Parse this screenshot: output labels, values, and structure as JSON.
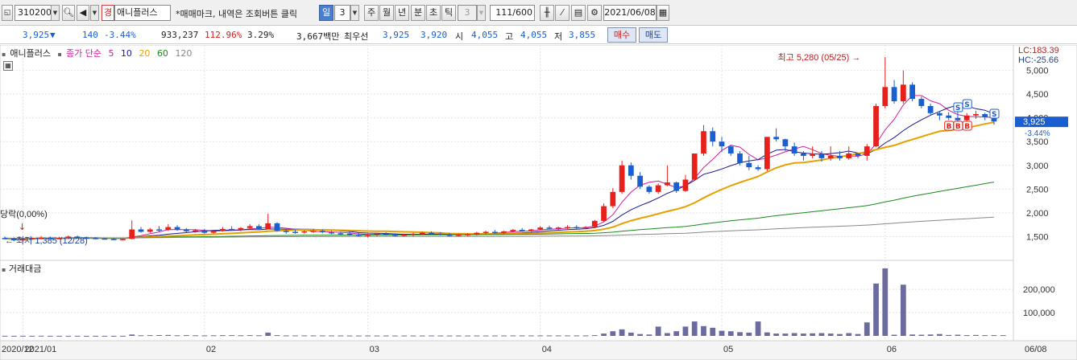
{
  "toolbar": {
    "code": "310200",
    "name_badge": "경",
    "name": "애니플러스",
    "notice": "*매매마크, 내역은 조회버튼 클릭",
    "period_tabs": [
      "일",
      "주",
      "월",
      "년",
      "분",
      "초",
      "틱"
    ],
    "active_period": "일",
    "period_value": "3",
    "minute_value": "3",
    "count": "111/600",
    "date": "2021/06/08"
  },
  "quote": {
    "price": "3,925",
    "change_arrow": "▼",
    "change": "140",
    "change_rate": "-3.44%",
    "volume": "933,237",
    "vol_ratio": "112.96%",
    "turnover": "3.29%",
    "amount": "3,667백만",
    "best_ask_label": "최우선",
    "best_ask": "3,925",
    "best_bid": "3,920",
    "open_label": "시",
    "open": "4,055",
    "high_label": "고",
    "high": "4,055",
    "low_label": "저",
    "low": "3,855",
    "buy_label": "매수",
    "sell_label": "매도"
  },
  "legend": {
    "name": "애니플러스",
    "ma_label": "종가 단순",
    "ma_periods": [
      "5",
      "10",
      "20",
      "60",
      "120"
    ],
    "ma_colors": [
      "#d0209c",
      "#1a1a8c",
      "#e8a000",
      "#1a8a1a",
      "#888888"
    ]
  },
  "volume_label": "거래대금",
  "annotations": {
    "high": "최고 5,280 (05/25) →",
    "low": "← 최저 1,385 (12/28)",
    "change_mark": "당락(0,00%)",
    "lc": "LC:183.39",
    "hc": "HC:-25.66",
    "current_price": "3,925",
    "current_rate": "-3.44%"
  },
  "colors": {
    "up": "#e8201c",
    "down": "#1a5fd0",
    "volume": "#6b6ba0",
    "price_box": "#1a5fd0"
  },
  "chart_data": {
    "type": "candlestick",
    "price_axis": {
      "ticks": [
        "5,000",
        "4,500",
        "4,000",
        "3,500",
        "3,000",
        "2,500",
        "2,000",
        "1,500"
      ],
      "min": 1100,
      "max": 5400
    },
    "volume_axis": {
      "ticks": [
        "200,000",
        "100,000"
      ],
      "max": 290000
    },
    "x_labels": [
      "2020/12",
      "2021/01",
      "02",
      "03",
      "04",
      "05",
      "06",
      "06/08"
    ],
    "x_label_index": [
      0,
      2,
      22,
      40,
      59,
      79,
      97,
      110
    ],
    "candles": [
      [
        1470,
        1500,
        1440,
        1460
      ],
      [
        1460,
        1480,
        1400,
        1420
      ],
      [
        1420,
        1460,
        1385,
        1450
      ],
      [
        1450,
        1480,
        1430,
        1470
      ],
      [
        1470,
        1510,
        1450,
        1480
      ],
      [
        1480,
        1500,
        1450,
        1460
      ],
      [
        1460,
        1490,
        1440,
        1470
      ],
      [
        1470,
        1520,
        1450,
        1500
      ],
      [
        1500,
        1520,
        1470,
        1480
      ],
      [
        1480,
        1500,
        1460,
        1470
      ],
      [
        1470,
        1490,
        1440,
        1460
      ],
      [
        1460,
        1480,
        1440,
        1450
      ],
      [
        1450,
        1470,
        1430,
        1440
      ],
      [
        1440,
        1460,
        1420,
        1450
      ],
      [
        1450,
        1840,
        1440,
        1650
      ],
      [
        1650,
        1700,
        1580,
        1600
      ],
      [
        1600,
        1680,
        1580,
        1650
      ],
      [
        1650,
        1720,
        1600,
        1640
      ],
      [
        1640,
        1760,
        1620,
        1700
      ],
      [
        1700,
        1740,
        1620,
        1640
      ],
      [
        1640,
        1680,
        1580,
        1610
      ],
      [
        1610,
        1660,
        1580,
        1630
      ],
      [
        1630,
        1660,
        1560,
        1580
      ],
      [
        1580,
        1640,
        1560,
        1620
      ],
      [
        1620,
        1700,
        1600,
        1660
      ],
      [
        1660,
        1720,
        1620,
        1640
      ],
      [
        1640,
        1700,
        1610,
        1680
      ],
      [
        1680,
        1760,
        1650,
        1720
      ],
      [
        1720,
        1760,
        1640,
        1660
      ],
      [
        1660,
        1980,
        1650,
        1780
      ],
      [
        1780,
        1800,
        1600,
        1620
      ],
      [
        1620,
        1660,
        1560,
        1600
      ],
      [
        1600,
        1640,
        1560,
        1590
      ],
      [
        1590,
        1630,
        1560,
        1610
      ],
      [
        1610,
        1660,
        1580,
        1620
      ],
      [
        1620,
        1650,
        1570,
        1590
      ],
      [
        1590,
        1620,
        1550,
        1570
      ],
      [
        1570,
        1600,
        1530,
        1560
      ],
      [
        1560,
        1600,
        1520,
        1540
      ],
      [
        1540,
        1580,
        1500,
        1520
      ],
      [
        1520,
        1560,
        1480,
        1540
      ],
      [
        1540,
        1580,
        1510,
        1560
      ],
      [
        1560,
        1590,
        1520,
        1540
      ],
      [
        1540,
        1570,
        1500,
        1520
      ],
      [
        1520,
        1560,
        1500,
        1540
      ],
      [
        1540,
        1580,
        1510,
        1560
      ],
      [
        1560,
        1600,
        1530,
        1580
      ],
      [
        1580,
        1610,
        1540,
        1560
      ],
      [
        1560,
        1590,
        1520,
        1540
      ],
      [
        1540,
        1580,
        1500,
        1520
      ],
      [
        1520,
        1560,
        1500,
        1540
      ],
      [
        1540,
        1570,
        1510,
        1550
      ],
      [
        1550,
        1600,
        1520,
        1580
      ],
      [
        1580,
        1620,
        1550,
        1600
      ],
      [
        1600,
        1640,
        1560,
        1580
      ],
      [
        1580,
        1620,
        1550,
        1610
      ],
      [
        1610,
        1660,
        1590,
        1640
      ],
      [
        1640,
        1680,
        1600,
        1620
      ],
      [
        1620,
        1660,
        1600,
        1650
      ],
      [
        1650,
        1720,
        1630,
        1690
      ],
      [
        1690,
        1730,
        1650,
        1670
      ],
      [
        1670,
        1710,
        1640,
        1690
      ],
      [
        1690,
        1740,
        1660,
        1700
      ],
      [
        1700,
        1740,
        1660,
        1680
      ],
      [
        1680,
        1720,
        1650,
        1700
      ],
      [
        1700,
        1850,
        1690,
        1830
      ],
      [
        1830,
        2200,
        1800,
        2140
      ],
      [
        2140,
        2520,
        2100,
        2440
      ],
      [
        2440,
        3100,
        2400,
        3000
      ],
      [
        3000,
        3060,
        2700,
        2780
      ],
      [
        2780,
        2860,
        2500,
        2550
      ],
      [
        2550,
        2580,
        2400,
        2440
      ],
      [
        2440,
        2620,
        2400,
        2580
      ],
      [
        2580,
        3000,
        2560,
        2640
      ],
      [
        2640,
        2660,
        2420,
        2460
      ],
      [
        2460,
        2800,
        2440,
        2700
      ],
      [
        2700,
        3200,
        2680,
        3250
      ],
      [
        3250,
        3850,
        3200,
        3720
      ],
      [
        3720,
        3800,
        3400,
        3500
      ],
      [
        3500,
        3600,
        3280,
        3400
      ],
      [
        3400,
        3420,
        3200,
        3250
      ],
      [
        3250,
        3300,
        3000,
        3050
      ],
      [
        3050,
        3200,
        2900,
        2960
      ],
      [
        2960,
        3000,
        2880,
        2920
      ],
      [
        2920,
        3300,
        2880,
        3600
      ],
      [
        3600,
        3780,
        3500,
        3550
      ],
      [
        3550,
        3560,
        3300,
        3400
      ],
      [
        3400,
        3480,
        3200,
        3250
      ],
      [
        3250,
        3300,
        3100,
        3200
      ],
      [
        3200,
        3400,
        3150,
        3250
      ],
      [
        3250,
        3300,
        3080,
        3150
      ],
      [
        3150,
        3400,
        3100,
        3200
      ],
      [
        3200,
        3300,
        3100,
        3150
      ],
      [
        3150,
        3400,
        3120,
        3250
      ],
      [
        3250,
        3260,
        3150,
        3200
      ],
      [
        3200,
        3450,
        3100,
        3400
      ],
      [
        3400,
        4300,
        3380,
        4250
      ],
      [
        4250,
        5280,
        4200,
        4650
      ],
      [
        4650,
        4800,
        4300,
        4350
      ],
      [
        4350,
        5000,
        4300,
        4700
      ],
      [
        4700,
        4750,
        4350,
        4400
      ],
      [
        4400,
        4450,
        4200,
        4250
      ],
      [
        4250,
        4300,
        4050,
        4100
      ],
      [
        4100,
        4150,
        3950,
        4050
      ],
      [
        4050,
        4120,
        3950,
        4000
      ],
      [
        4000,
        4150,
        3900,
        3950
      ],
      [
        3950,
        4100,
        3900,
        4050
      ],
      [
        4050,
        4150,
        3980,
        4080
      ],
      [
        4080,
        4110,
        3950,
        4020
      ],
      [
        4065,
        4055,
        3855,
        3925
      ]
    ],
    "volume": [
      500,
      300,
      600,
      400,
      700,
      500,
      300,
      500,
      400,
      300,
      300,
      400,
      300,
      400,
      6000,
      2500,
      3000,
      3500,
      4000,
      2500,
      3000,
      2500,
      2000,
      2500,
      3000,
      3000,
      2500,
      3000,
      2500,
      14000,
      3000,
      2000,
      2000,
      2000,
      2000,
      1800,
      1800,
      1600,
      1600,
      1500,
      1500,
      1500,
      1500,
      1500,
      1500,
      1500,
      1600,
      1600,
      1500,
      1500,
      1500,
      1500,
      1600,
      1600,
      1600,
      1700,
      1800,
      1800,
      1800,
      2000,
      2000,
      2000,
      2000,
      2000,
      2000,
      3000,
      10000,
      20000,
      28000,
      14000,
      8000,
      6000,
      40000,
      12000,
      20000,
      40000,
      62000,
      42000,
      35000,
      22000,
      20000,
      16000,
      14000,
      62000,
      15000,
      10000,
      10000,
      12000,
      10000,
      11000,
      12000,
      10000,
      8000,
      12000,
      8000,
      58000,
      225000,
      290000,
      5000,
      220000,
      6000,
      5000,
      6000,
      8000,
      4000,
      5000,
      3000,
      4000,
      3000,
      3000,
      3000
    ],
    "ma": {
      "5": true,
      "10": true,
      "20": true,
      "60": true,
      "120": true
    },
    "markers": [
      {
        "label": "S",
        "index": 105,
        "color": "#1a5fd0"
      },
      {
        "label": "S",
        "index": 106,
        "color": "#1a5fd0"
      },
      {
        "label": "S",
        "index": 109,
        "color": "#1a5fd0"
      },
      {
        "label": "B",
        "index": 104,
        "color": "#e8201c"
      },
      {
        "label": "B",
        "index": 105,
        "color": "#e8201c"
      },
      {
        "label": "B",
        "index": 106,
        "color": "#e8201c"
      }
    ]
  }
}
